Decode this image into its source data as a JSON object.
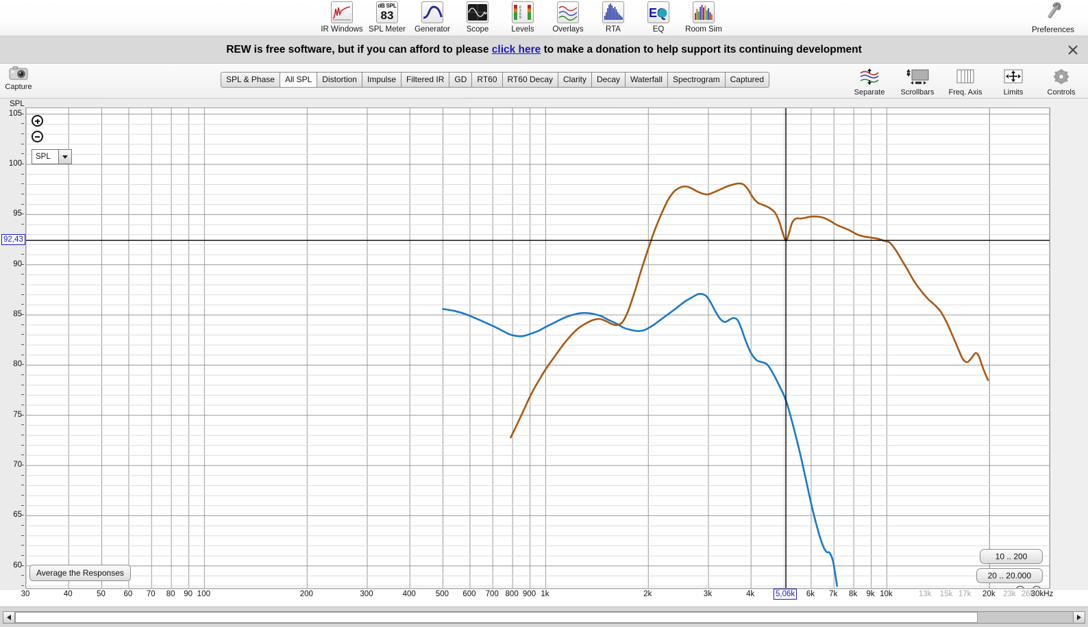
{
  "toolbar": {
    "items": [
      {
        "label": "IR Windows",
        "icon": "ir-windows-icon"
      },
      {
        "label": "SPL Meter",
        "icon": "spl-meter-icon",
        "unit": "dB SPL",
        "value": "83"
      },
      {
        "label": "Generator",
        "icon": "generator-icon"
      },
      {
        "label": "Scope",
        "icon": "scope-icon"
      },
      {
        "label": "Levels",
        "icon": "levels-icon",
        "scale": "0369"
      },
      {
        "label": "Overlays",
        "icon": "overlays-icon"
      },
      {
        "label": "RTA",
        "icon": "rta-icon"
      },
      {
        "label": "EQ",
        "icon": "eq-icon",
        "glyph": "EQ"
      },
      {
        "label": "Room Sim",
        "icon": "room-sim-icon"
      }
    ],
    "preferences": {
      "label": "Preferences",
      "icon": "wrench-icon"
    }
  },
  "banner": {
    "prefix": "REW is free software, but if you can afford to please ",
    "link": "click here",
    "suffix": " to make a donation to help support its continuing development",
    "close_icon": "close-icon"
  },
  "capture": {
    "label": "Capture",
    "icon": "camera-icon"
  },
  "tabs": [
    {
      "label": "SPL & Phase",
      "active": false
    },
    {
      "label": "All SPL",
      "active": true
    },
    {
      "label": "Distortion",
      "active": false
    },
    {
      "label": "Impulse",
      "active": false
    },
    {
      "label": "Filtered IR",
      "active": false
    },
    {
      "label": "GD",
      "active": false
    },
    {
      "label": "RT60",
      "active": false
    },
    {
      "label": "RT60 Decay",
      "active": false
    },
    {
      "label": "Clarity",
      "active": false
    },
    {
      "label": "Decay",
      "active": false
    },
    {
      "label": "Waterfall",
      "active": false
    },
    {
      "label": "Spectrogram",
      "active": false
    },
    {
      "label": "Captured",
      "active": false
    }
  ],
  "right_tools": [
    {
      "label": "Separate",
      "icon": "separate-traces-icon"
    },
    {
      "label": "Scrollbars",
      "icon": "scrollbars-icon"
    },
    {
      "label": "Freq. Axis",
      "icon": "freq-axis-icon"
    },
    {
      "label": "Limits",
      "icon": "limits-icon"
    },
    {
      "label": "Controls",
      "icon": "gear-icon"
    }
  ],
  "graph_controls": {
    "zoom_in_icon": "zoom-in-icon",
    "zoom_out_icon": "zoom-out-icon",
    "measurement_select": "SPL",
    "average_button": "Average the Responses",
    "range_button_1": "10 .. 200",
    "range_button_2": "20 .. 20.000",
    "axis_zoom_out_icon": "zoom-out-icon",
    "axis_zoom_in_icon": "zoom-in-icon"
  },
  "cursor": {
    "y_value": "92,43",
    "x_value": "5,06k"
  },
  "chart_data": {
    "type": "line",
    "title": "",
    "xlabel": "",
    "ylabel": "SPL",
    "y_axis_unit": "SPL",
    "xscale": "log",
    "grid": true,
    "xlim": [
      30,
      30000
    ],
    "ylim": [
      57.8,
      105.6
    ],
    "yticks": [
      105,
      100,
      95,
      90,
      85,
      80,
      75,
      70,
      65,
      60
    ],
    "xticks": [
      {
        "value": 30,
        "label": "30",
        "dim": false
      },
      {
        "value": 40,
        "label": "40",
        "dim": false
      },
      {
        "value": 50,
        "label": "50",
        "dim": false
      },
      {
        "value": 60,
        "label": "60",
        "dim": false
      },
      {
        "value": 70,
        "label": "70",
        "dim": false
      },
      {
        "value": 80,
        "label": "80",
        "dim": false
      },
      {
        "value": 90,
        "label": "90",
        "dim": false
      },
      {
        "value": 100,
        "label": "100",
        "dim": false
      },
      {
        "value": 200,
        "label": "200",
        "dim": false
      },
      {
        "value": 300,
        "label": "300",
        "dim": false
      },
      {
        "value": 400,
        "label": "400",
        "dim": false
      },
      {
        "value": 500,
        "label": "500",
        "dim": false
      },
      {
        "value": 600,
        "label": "600",
        "dim": false
      },
      {
        "value": 700,
        "label": "700",
        "dim": false
      },
      {
        "value": 800,
        "label": "800",
        "dim": false
      },
      {
        "value": 900,
        "label": "900",
        "dim": false
      },
      {
        "value": 1000,
        "label": "1k",
        "dim": false
      },
      {
        "value": 2000,
        "label": "2k",
        "dim": false
      },
      {
        "value": 3000,
        "label": "3k",
        "dim": false
      },
      {
        "value": 4000,
        "label": "4k",
        "dim": false
      },
      {
        "value": 6000,
        "label": "6k",
        "dim": false
      },
      {
        "value": 7000,
        "label": "7k",
        "dim": false
      },
      {
        "value": 8000,
        "label": "8k",
        "dim": false
      },
      {
        "value": 9000,
        "label": "9k",
        "dim": false
      },
      {
        "value": 10000,
        "label": "10k",
        "dim": false
      },
      {
        "value": 13000,
        "label": "13k",
        "dim": true
      },
      {
        "value": 15000,
        "label": "15k",
        "dim": true
      },
      {
        "value": 17000,
        "label": "17k",
        "dim": true
      },
      {
        "value": 20000,
        "label": "20k",
        "dim": false
      },
      {
        "value": 23000,
        "label": "23k",
        "dim": true
      },
      {
        "value": 26000,
        "label": "26k",
        "dim": true
      },
      {
        "value": 30000,
        "label": "30kHz",
        "dim": false
      }
    ],
    "cursor_lines": {
      "x": 5060,
      "y": 92.43,
      "color": "#000000"
    },
    "series": [
      {
        "name": "measurement-blue",
        "color": "#1878c8",
        "points": [
          [
            500,
            85.6
          ],
          [
            540,
            85.4
          ],
          [
            580,
            85.1
          ],
          [
            620,
            84.7
          ],
          [
            660,
            84.3
          ],
          [
            700,
            83.9
          ],
          [
            740,
            83.5
          ],
          [
            780,
            83.1
          ],
          [
            820,
            82.9
          ],
          [
            860,
            82.9
          ],
          [
            900,
            83.1
          ],
          [
            950,
            83.4
          ],
          [
            1000,
            83.8
          ],
          [
            1070,
            84.3
          ],
          [
            1150,
            84.8
          ],
          [
            1230,
            85.1
          ],
          [
            1300,
            85.2
          ],
          [
            1380,
            85.1
          ],
          [
            1450,
            84.9
          ],
          [
            1530,
            84.5
          ],
          [
            1620,
            84.1
          ],
          [
            1700,
            83.7
          ],
          [
            1780,
            83.5
          ],
          [
            1860,
            83.4
          ],
          [
            1950,
            83.5
          ],
          [
            2050,
            83.9
          ],
          [
            2150,
            84.4
          ],
          [
            2250,
            84.9
          ],
          [
            2400,
            85.6
          ],
          [
            2550,
            86.3
          ],
          [
            2700,
            86.8
          ],
          [
            2820,
            87.1
          ],
          [
            2950,
            86.9
          ],
          [
            3050,
            86.2
          ],
          [
            3150,
            85.3
          ],
          [
            3250,
            84.6
          ],
          [
            3350,
            84.3
          ],
          [
            3450,
            84.5
          ],
          [
            3550,
            84.7
          ],
          [
            3650,
            84.5
          ],
          [
            3750,
            83.6
          ],
          [
            3870,
            82.3
          ],
          [
            4000,
            81.2
          ],
          [
            4150,
            80.5
          ],
          [
            4300,
            80.3
          ],
          [
            4450,
            80.1
          ],
          [
            4600,
            79.4
          ],
          [
            4800,
            78.2
          ],
          [
            5060,
            76.5
          ],
          [
            5300,
            74.1
          ],
          [
            5550,
            71.4
          ],
          [
            5800,
            68.5
          ],
          [
            6050,
            65.7
          ],
          [
            6300,
            63.4
          ],
          [
            6500,
            62.0
          ],
          [
            6650,
            61.4
          ],
          [
            6800,
            61.3
          ],
          [
            6950,
            60.5
          ],
          [
            7050,
            59.3
          ],
          [
            7150,
            58.0
          ]
        ]
      },
      {
        "name": "measurement-brown",
        "color": "#a9580f",
        "points": [
          [
            790,
            72.8
          ],
          [
            830,
            74.3
          ],
          [
            870,
            75.8
          ],
          [
            910,
            77.2
          ],
          [
            960,
            78.6
          ],
          [
            1010,
            79.8
          ],
          [
            1070,
            81.0
          ],
          [
            1130,
            82.1
          ],
          [
            1190,
            83.0
          ],
          [
            1250,
            83.7
          ],
          [
            1320,
            84.2
          ],
          [
            1380,
            84.5
          ],
          [
            1440,
            84.6
          ],
          [
            1500,
            84.4
          ],
          [
            1560,
            84.1
          ],
          [
            1620,
            84.0
          ],
          [
            1680,
            84.3
          ],
          [
            1740,
            85.3
          ],
          [
            1820,
            87.2
          ],
          [
            1900,
            89.3
          ],
          [
            1990,
            91.4
          ],
          [
            2080,
            93.3
          ],
          [
            2180,
            95.0
          ],
          [
            2280,
            96.4
          ],
          [
            2380,
            97.3
          ],
          [
            2480,
            97.7
          ],
          [
            2580,
            97.8
          ],
          [
            2680,
            97.6
          ],
          [
            2780,
            97.3
          ],
          [
            2880,
            97.1
          ],
          [
            2980,
            97.0
          ],
          [
            3100,
            97.2
          ],
          [
            3250,
            97.5
          ],
          [
            3400,
            97.8
          ],
          [
            3550,
            98.0
          ],
          [
            3680,
            98.1
          ],
          [
            3800,
            98.0
          ],
          [
            3920,
            97.5
          ],
          [
            4050,
            96.7
          ],
          [
            4180,
            96.2
          ],
          [
            4300,
            96.0
          ],
          [
            4450,
            95.8
          ],
          [
            4600,
            95.5
          ],
          [
            4720,
            95.1
          ],
          [
            4850,
            94.2
          ],
          [
            4950,
            93.2
          ],
          [
            5060,
            92.4
          ],
          [
            5150,
            93.0
          ],
          [
            5280,
            94.2
          ],
          [
            5420,
            94.6
          ],
          [
            5600,
            94.6
          ],
          [
            5800,
            94.7
          ],
          [
            6000,
            94.8
          ],
          [
            6250,
            94.8
          ],
          [
            6500,
            94.7
          ],
          [
            6800,
            94.4
          ],
          [
            7100,
            94.0
          ],
          [
            7450,
            93.7
          ],
          [
            7800,
            93.4
          ],
          [
            8200,
            93.0
          ],
          [
            8600,
            92.8
          ],
          [
            9000,
            92.7
          ],
          [
            9400,
            92.6
          ],
          [
            9800,
            92.4
          ],
          [
            10200,
            92.2
          ],
          [
            10600,
            91.5
          ],
          [
            11000,
            90.6
          ],
          [
            11500,
            89.5
          ],
          [
            12000,
            88.4
          ],
          [
            12600,
            87.4
          ],
          [
            13200,
            86.6
          ],
          [
            13800,
            86.0
          ],
          [
            14400,
            85.3
          ],
          [
            15000,
            84.2
          ],
          [
            15600,
            82.9
          ],
          [
            16200,
            81.6
          ],
          [
            16700,
            80.6
          ],
          [
            17200,
            80.3
          ],
          [
            17700,
            80.7
          ],
          [
            18200,
            81.2
          ],
          [
            18600,
            80.9
          ],
          [
            19000,
            80.0
          ],
          [
            19400,
            79.2
          ],
          [
            19800,
            78.5
          ]
        ]
      }
    ]
  },
  "scrollbar": {
    "left_arrow_icon": "chevron-left-icon",
    "right_arrow_icon": "chevron-right-icon"
  }
}
